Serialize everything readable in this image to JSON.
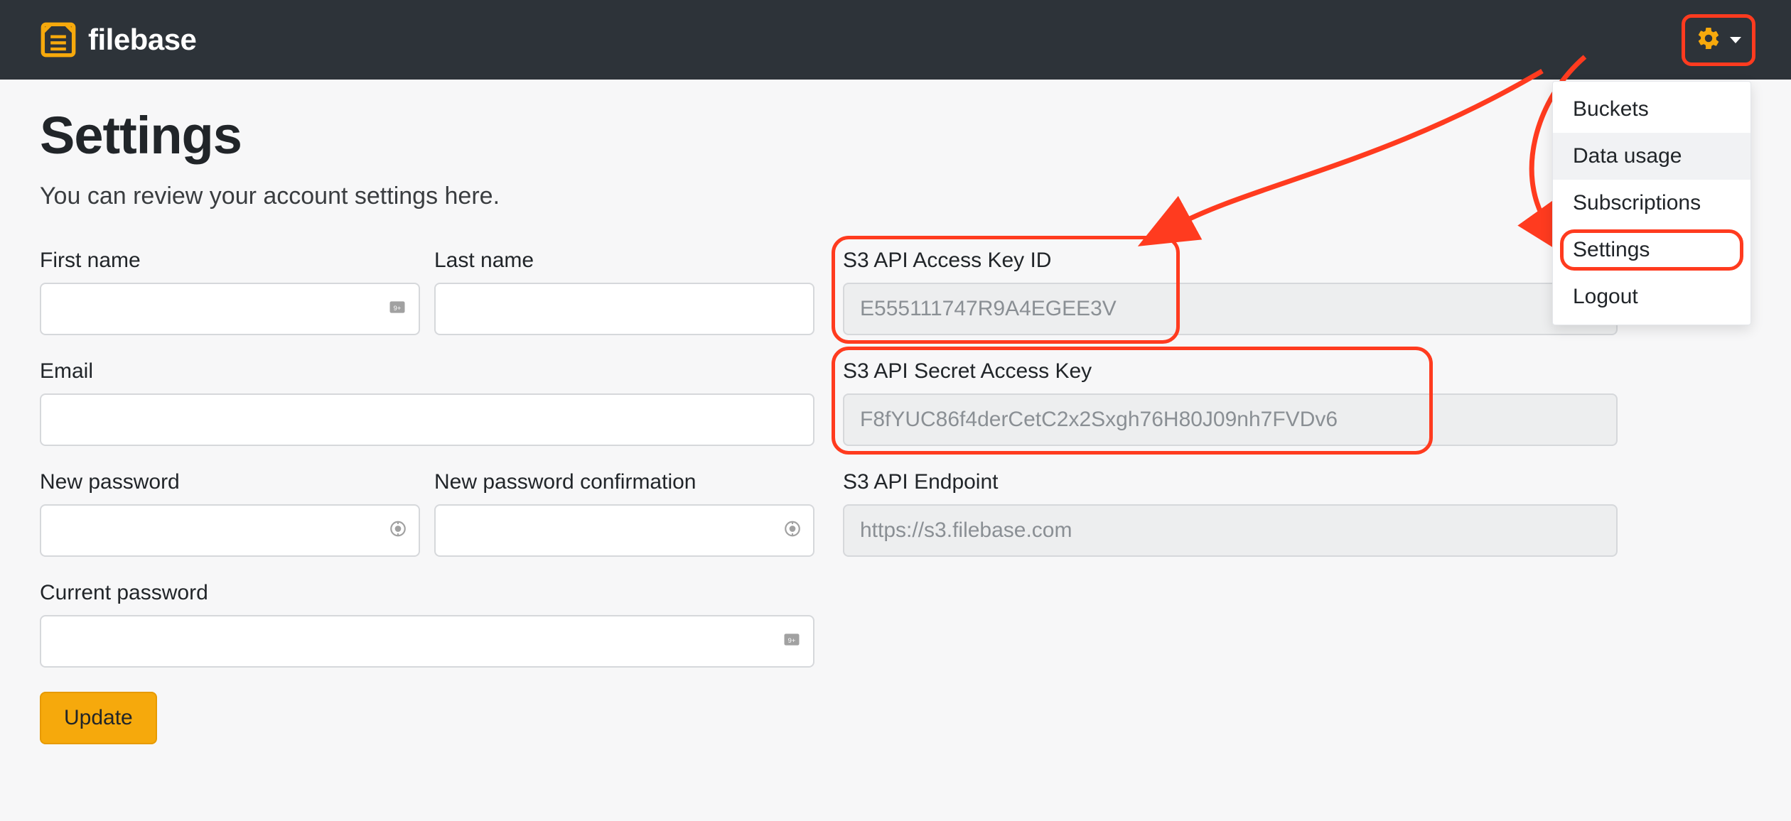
{
  "brand": {
    "name": "filebase"
  },
  "dropdown": {
    "items": [
      {
        "label": "Buckets",
        "highlighted": false,
        "hover": false
      },
      {
        "label": "Data usage",
        "highlighted": false,
        "hover": true
      },
      {
        "label": "Subscriptions",
        "highlighted": false,
        "hover": false
      },
      {
        "label": "Settings",
        "highlighted": true,
        "hover": false
      },
      {
        "label": "Logout",
        "highlighted": false,
        "hover": false
      }
    ]
  },
  "page": {
    "title": "Settings",
    "subtitle": "You can review your account settings here."
  },
  "form": {
    "first_name": {
      "label": "First name",
      "value": ""
    },
    "last_name": {
      "label": "Last name",
      "value": ""
    },
    "email": {
      "label": "Email",
      "value": ""
    },
    "new_password": {
      "label": "New password",
      "value": ""
    },
    "new_password_confirm": {
      "label": "New password confirmation",
      "value": ""
    },
    "current_password": {
      "label": "Current password",
      "value": ""
    },
    "update_button": "Update"
  },
  "api": {
    "access_key": {
      "label": "S3 API Access Key ID",
      "value": "E555111747R9A4EGEE3V"
    },
    "secret_key": {
      "label": "S3 API Secret Access Key",
      "value": "F8fYUC86f4derCetC2x2Sxgh76H80J09nh7FVDv6"
    },
    "endpoint": {
      "label": "S3 API Endpoint",
      "value": "https://s3.filebase.com"
    }
  }
}
